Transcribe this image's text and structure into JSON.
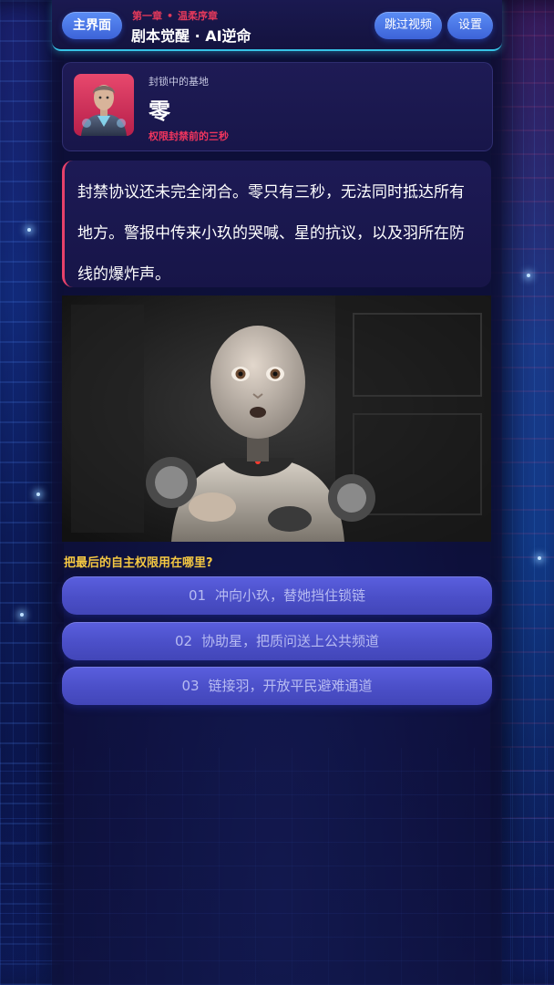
{
  "header": {
    "home_label": "主界面",
    "chapter_label": "第一章",
    "chapter_separator": "•",
    "chapter_name": "温柔序章",
    "game_title": "剧本觉醒 · AI逆命",
    "skip_label": "跳过视频",
    "settings_label": "设置"
  },
  "speaker": {
    "location": "封锁中的基地",
    "name": "零",
    "status": "权限封禁前的三秒",
    "avatar_color": "#e8486d"
  },
  "dialogue": {
    "text": "封禁协议还未完全闭合。零只有三秒，无法同时抵达所有地方。警报中传来小玖的哭喊、星的抗议，以及羽所在防线的爆炸声。"
  },
  "question": "把最后的自主权限用在哪里?",
  "choices": [
    {
      "number": "01",
      "label": "冲向小玖，替她挡住锁链"
    },
    {
      "number": "02",
      "label": "协助星，把质问送上公共频道"
    },
    {
      "number": "03",
      "label": "链接羽，开放平民避难通道"
    }
  ],
  "colors": {
    "accent_red": "#e2395b",
    "question_yellow": "#f5c842",
    "button_blue": "#4b4fc8",
    "header_line": "#37c3e6"
  }
}
